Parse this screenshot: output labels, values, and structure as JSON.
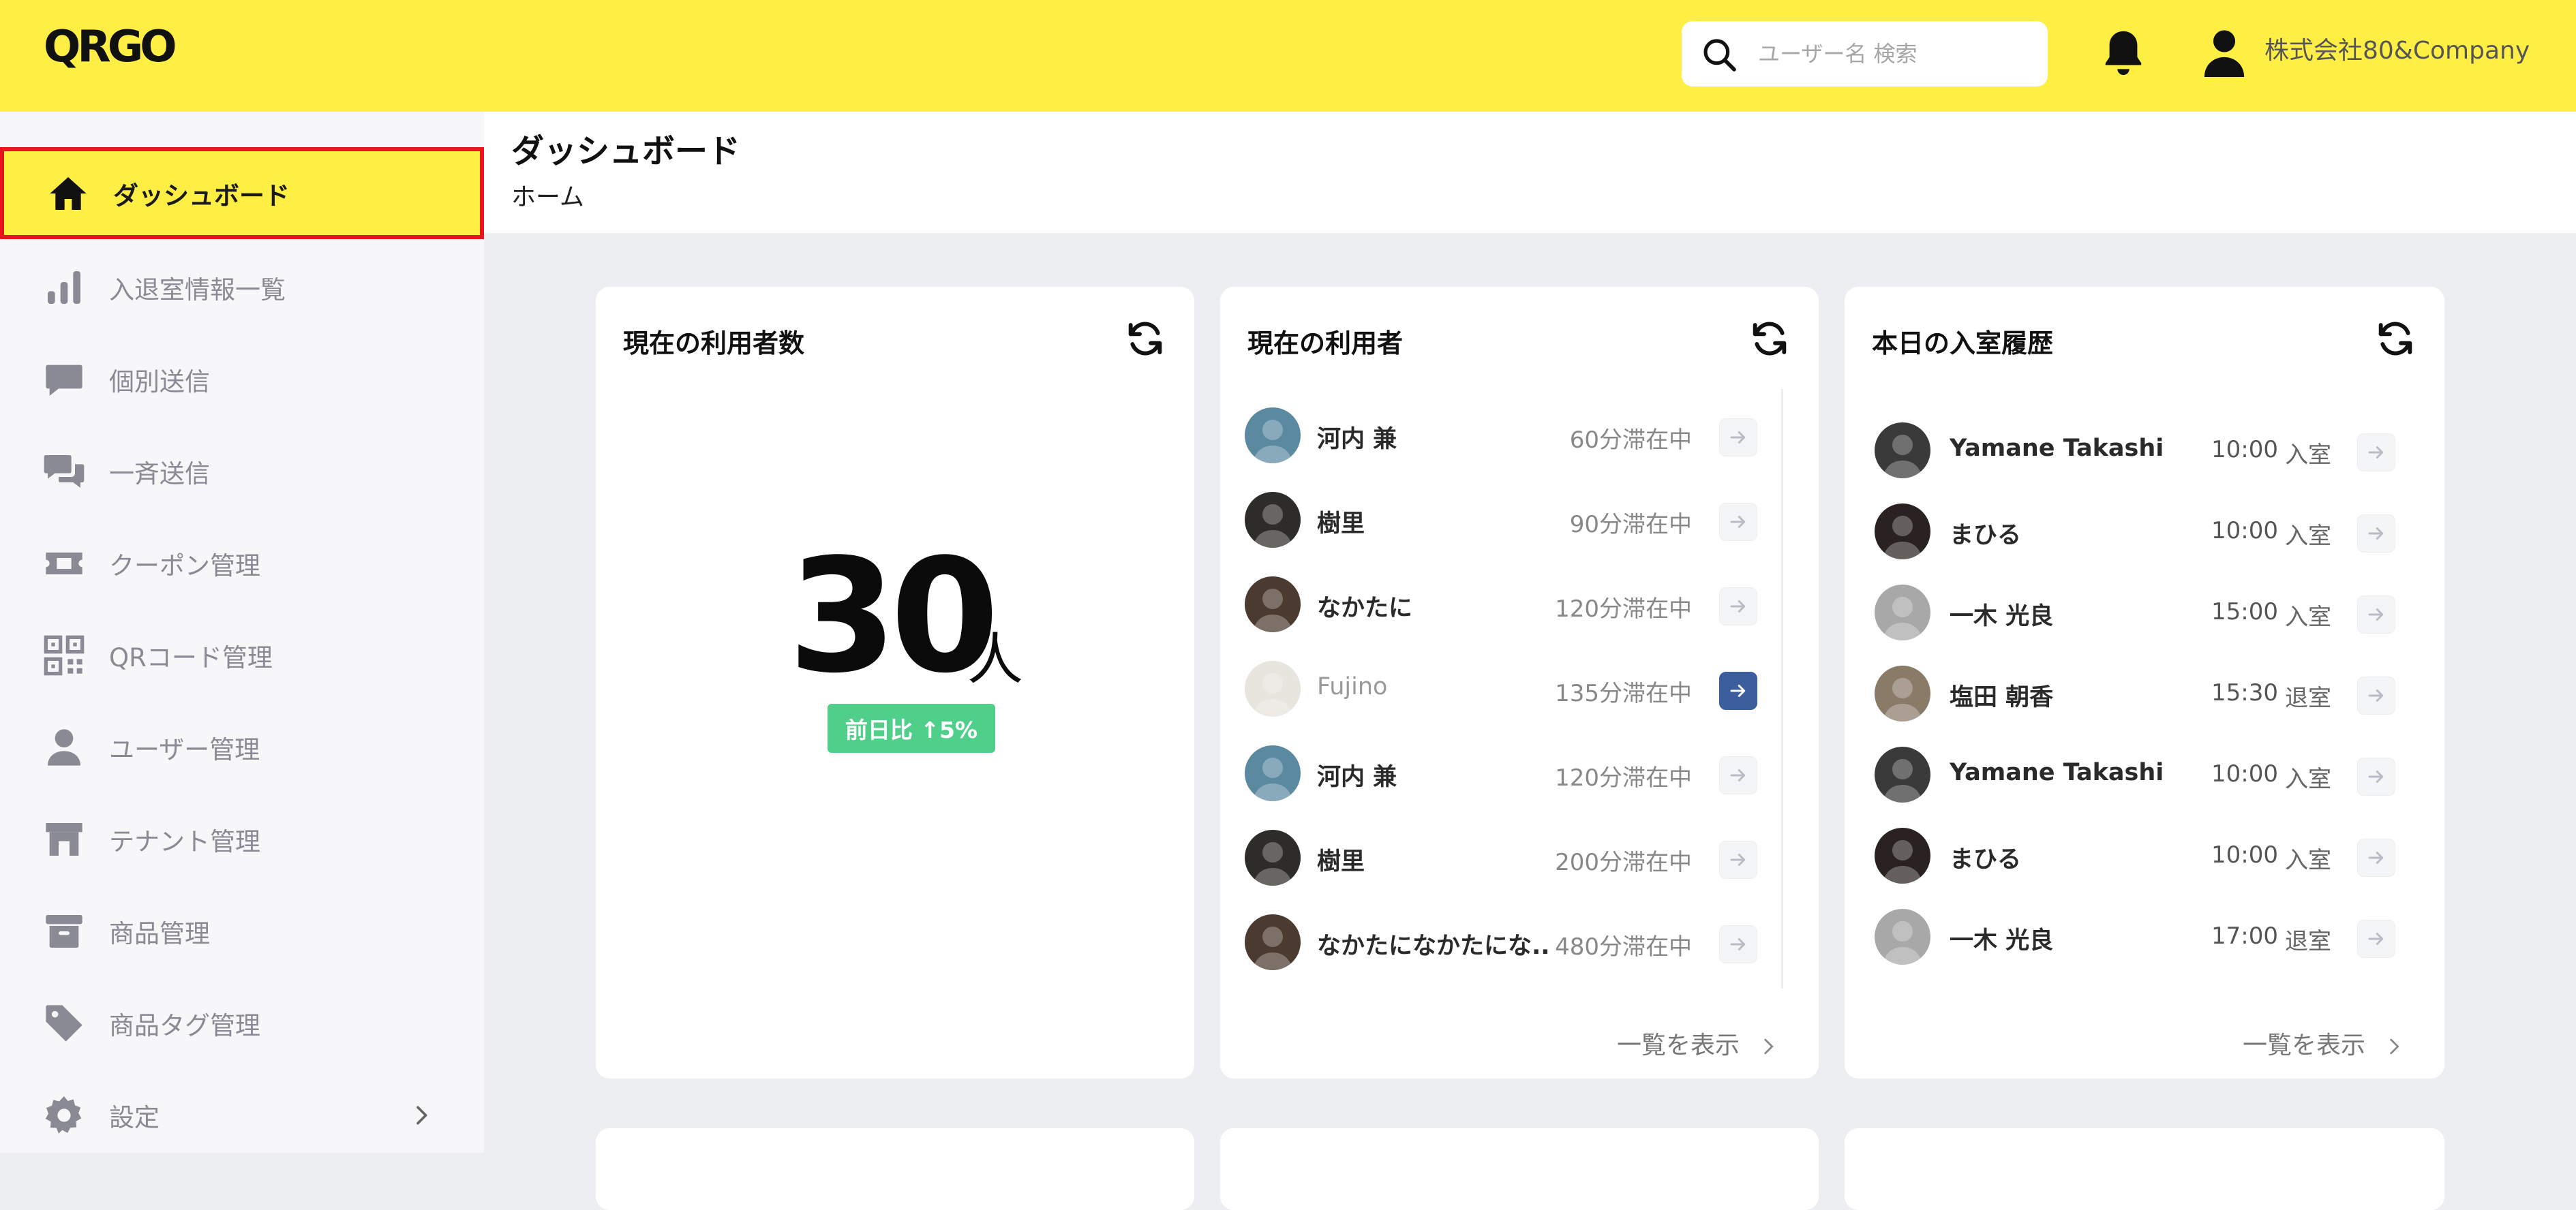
{
  "app": {
    "logo": "QRGO"
  },
  "search": {
    "placeholder": "ユーザー名 検索"
  },
  "account": {
    "name": "株式会社80&Company"
  },
  "sidebar": {
    "items": [
      {
        "label": "ダッシュボード",
        "icon": "home-icon",
        "active": true
      },
      {
        "label": "入退室情報一覧",
        "icon": "bar-chart-icon"
      },
      {
        "label": "個別送信",
        "icon": "chat-bubble-icon"
      },
      {
        "label": "一斉送信",
        "icon": "chat-bubbles-icon"
      },
      {
        "label": "クーポン管理",
        "icon": "ticket-icon"
      },
      {
        "label": "QRコード管理",
        "icon": "qr-code-icon"
      },
      {
        "label": "ユーザー管理",
        "icon": "person-icon"
      },
      {
        "label": "テナント管理",
        "icon": "store-icon"
      },
      {
        "label": "商品管理",
        "icon": "archive-box-icon"
      },
      {
        "label": "商品タグ管理",
        "icon": "tag-icon"
      },
      {
        "label": "設定",
        "icon": "gear-icon",
        "has_submenu": true
      }
    ]
  },
  "header": {
    "title": "ダッシュボード",
    "breadcrumb": "ホーム"
  },
  "cards": {
    "current_count": {
      "title": "現在の利用者数",
      "value": "30",
      "unit": "人",
      "trend": "前日比 ↑5%"
    },
    "current_users": {
      "title": "現在の利用者",
      "more": "一覧を表示",
      "rows": [
        {
          "name": "河内 兼",
          "stay": "60分滞在中",
          "avatar": "#5b8aa0"
        },
        {
          "name": "樹里",
          "stay": "90分滞在中",
          "avatar": "#2e2c28"
        },
        {
          "name": "なかたに",
          "stay": "120分滞在中",
          "avatar": "#4a3a30"
        },
        {
          "name": "Fujino",
          "stay": "135分滞在中",
          "avatar": "#e8e4de",
          "highlighted": true
        },
        {
          "name": "河内 兼",
          "stay": "120分滞在中",
          "avatar": "#5b8aa0"
        },
        {
          "name": "樹里",
          "stay": "200分滞在中",
          "avatar": "#2e2c28"
        },
        {
          "name": "なかたになかたにな...",
          "stay": "480分滞在中",
          "avatar": "#4a3a30"
        }
      ]
    },
    "today_history": {
      "title": "本日の入室履歴",
      "more": "一覧を表示",
      "rows": [
        {
          "name": "Yamane Takashi",
          "time": "10:00",
          "type": "入室",
          "avatar": "#3a3a3a"
        },
        {
          "name": "まひる",
          "time": "10:00",
          "type": "入室",
          "avatar": "#2a2220"
        },
        {
          "name": "一木 光良",
          "time": "15:00",
          "type": "入室",
          "avatar": "#a8a8a8"
        },
        {
          "name": "塩田 朝香",
          "time": "15:30",
          "type": "退室",
          "avatar": "#8a7a68"
        },
        {
          "name": "Yamane Takashi",
          "time": "10:00",
          "type": "入室",
          "avatar": "#3a3a3a"
        },
        {
          "name": "まひる",
          "time": "10:00",
          "type": "入室",
          "avatar": "#2a2220"
        },
        {
          "name": "一木 光良",
          "time": "17:00",
          "type": "退室",
          "avatar": "#a8a8a8"
        }
      ]
    }
  },
  "colors": {
    "brand_yellow": "#ffee44",
    "active_border": "#e8151c",
    "trend_green": "#4fcf8a",
    "arrow_active": "#3b5f9c"
  }
}
